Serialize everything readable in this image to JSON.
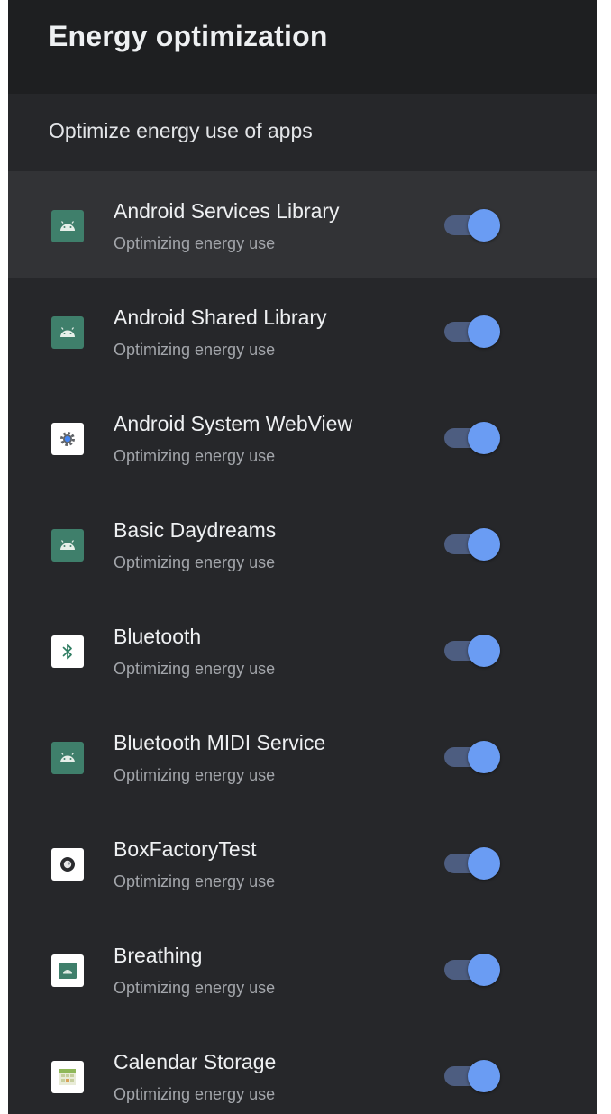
{
  "header": {
    "title": "Energy optimization"
  },
  "section": {
    "label": "Optimize energy use of apps"
  },
  "apps": [
    {
      "name": "Android Services Library",
      "status": "Optimizing energy use",
      "icon": "android-icon",
      "enabled": true
    },
    {
      "name": "Android Shared Library",
      "status": "Optimizing energy use",
      "icon": "android-icon",
      "enabled": true
    },
    {
      "name": "Android System WebView",
      "status": "Optimizing energy use",
      "icon": "webview-gear-icon",
      "enabled": true
    },
    {
      "name": "Basic Daydreams",
      "status": "Optimizing energy use",
      "icon": "android-icon",
      "enabled": true
    },
    {
      "name": "Bluetooth",
      "status": "Optimizing energy use",
      "icon": "bluetooth-icon",
      "enabled": true
    },
    {
      "name": "Bluetooth MIDI Service",
      "status": "Optimizing energy use",
      "icon": "android-icon",
      "enabled": true
    },
    {
      "name": "BoxFactoryTest",
      "status": "Optimizing energy use",
      "icon": "factory-test-icon",
      "enabled": true
    },
    {
      "name": "Breathing",
      "status": "Optimizing energy use",
      "icon": "breathing-icon",
      "enabled": true
    },
    {
      "name": "Calendar Storage",
      "status": "Optimizing energy use",
      "icon": "calendar-icon",
      "enabled": true
    }
  ],
  "colors": {
    "background": "#26272a",
    "header": "#1e1f21",
    "focused_row": "#323336",
    "toggle_thumb": "#6a9cf3",
    "toggle_track": "#4d5d80",
    "android_icon": "#3f7f6b"
  }
}
